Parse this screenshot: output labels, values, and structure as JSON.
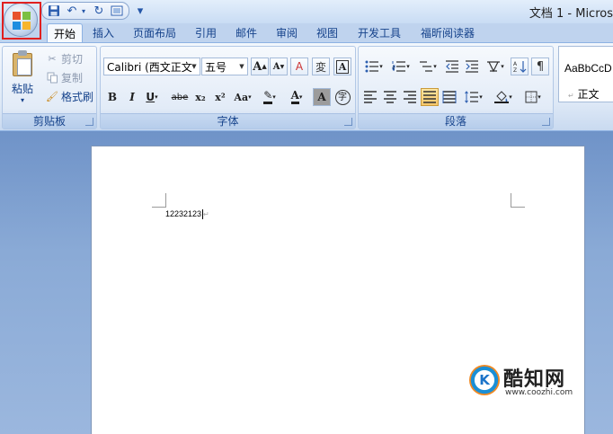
{
  "window": {
    "title": "文档 1 - Micros"
  },
  "quick_access": {
    "icons": [
      "save-icon",
      "undo-icon",
      "redo-icon",
      "print-preview-icon"
    ],
    "overflow": "▾"
  },
  "tabs": [
    {
      "label": "开始",
      "active": true
    },
    {
      "label": "插入"
    },
    {
      "label": "页面布局"
    },
    {
      "label": "引用"
    },
    {
      "label": "邮件"
    },
    {
      "label": "审阅"
    },
    {
      "label": "视图"
    },
    {
      "label": "开发工具"
    },
    {
      "label": "福昕阅读器"
    }
  ],
  "clipboard": {
    "group_label": "剪贴板",
    "paste_label": "粘贴",
    "cut_label": "剪切",
    "copy_label": "复制",
    "format_painter_label": "格式刷"
  },
  "font": {
    "group_label": "字体",
    "font_name": "Calibri (西文正文",
    "font_size": "五号",
    "buttons": {
      "grow": "A",
      "shrink": "A",
      "clear_format": "A",
      "phonetic": "変",
      "border": "A",
      "bold": "B",
      "italic": "I",
      "underline": "U",
      "strike": "abe",
      "subscript": "x₂",
      "superscript": "x²",
      "change_case": "Aa",
      "highlight": "✎",
      "font_color": "A",
      "shading": "A",
      "enclose": "字"
    }
  },
  "paragraph": {
    "group_label": "段落"
  },
  "styles": {
    "sample": "AaBbCcD",
    "name": "正文",
    "para_mark": "↵"
  },
  "document": {
    "text": "12232123"
  },
  "watermark": {
    "logo_letter": "K",
    "name": "酷知网",
    "url": "www.coozhi.com"
  },
  "colors": {
    "highlight_box": "#e02020",
    "ribbon_border": "#8db2e3",
    "accent_text": "#15428b",
    "page_bg": "#ffffff"
  }
}
